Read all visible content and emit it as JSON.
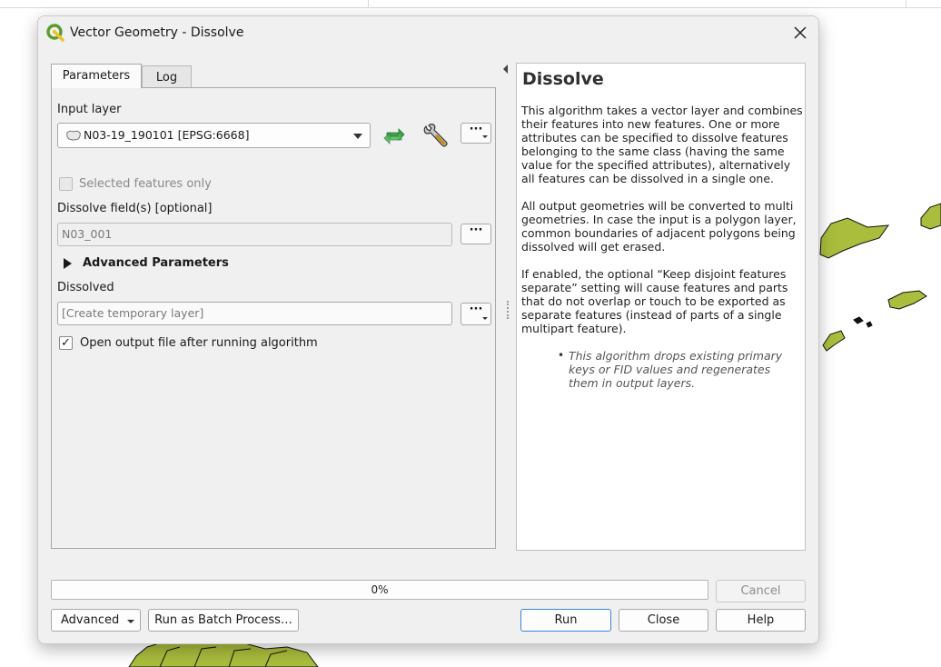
{
  "dialog": {
    "title": "Vector Geometry - Dissolve",
    "close_glyph": "✕"
  },
  "tabs": [
    {
      "label": "Parameters",
      "active": true
    },
    {
      "label": "Log",
      "active": false
    }
  ],
  "params": {
    "input_layer_label": "Input layer",
    "input_layer_value": "N03-19_190101 [EPSG:6668]",
    "selected_only_label": "Selected features only",
    "dissolve_fields_label": "Dissolve field(s) [optional]",
    "dissolve_fields_value": "N03_001",
    "advanced_label": "Advanced Parameters",
    "dissolved_label": "Dissolved",
    "dissolved_placeholder": "[Create temporary layer]",
    "open_output_label": "Open output file after running algorithm",
    "open_output_checked": true,
    "dots": "···",
    "check_glyph": "✓"
  },
  "help": {
    "title": "Dissolve",
    "para1": "This algorithm takes a vector layer and combines their features into new features. One or more attributes can be specified to dissolve features belonging to the same class (having the same value for the specified attributes), alternatively all features can be dissolved in a single one.",
    "para2": "All output geometries will be converted to multi geometries. In case the input is a polygon layer, common boundaries of adjacent polygons being dissolved will get erased.",
    "para3": "If enabled, the optional “Keep disjoint features separate” setting will cause features and parts that do not overlap or touch to be exported as separate features (instead of parts of a single multipart feature).",
    "note": "This algorithm drops existing primary keys or FID values and regenerates them in output layers.",
    "bullet": "•"
  },
  "progress": {
    "value": 0,
    "text": "0%"
  },
  "buttons": {
    "cancel": "Cancel",
    "advanced": "Advanced",
    "batch": "Run as Batch Process…",
    "run": "Run",
    "close": "Close",
    "help": "Help"
  },
  "colors": {
    "map_fill": "#aabd3c",
    "qgis_green": "#5b9c2f",
    "qgis_yellow": "#eec22a",
    "refresh_green": "#3fa24a",
    "progress_blue": "#3d8ee0"
  },
  "icons": {
    "app": "qgis-logo-icon",
    "layer": "polygon-layer-icon",
    "refresh": "iterate-refresh-icon",
    "settings": "wrench-icon"
  }
}
